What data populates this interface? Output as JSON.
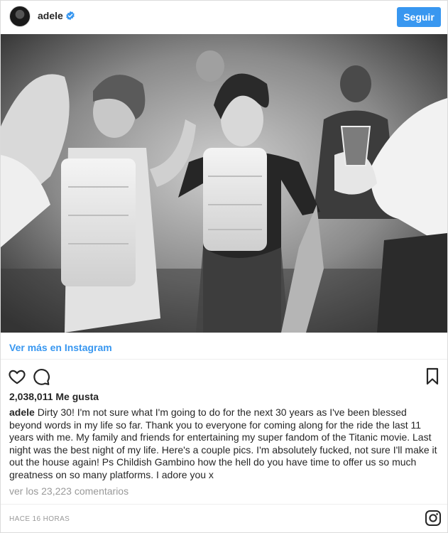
{
  "header": {
    "username": "adele",
    "verified": true,
    "follow_label": "Seguir"
  },
  "post": {
    "photo_icon": "image",
    "view_link": "Ver más en Instagram",
    "likes": "2,038,011 Me gusta",
    "caption_user": "adele",
    "caption_text": "Dirty 30! I'm not sure what I'm going to do for the next 30 years as I've been blessed beyond words in my life so far. Thank you to everyone for coming along for the ride the last 11 years with me. My family and friends for entertaining my super fandom of the Titanic movie. Last night was the best night of my life. Here's a couple pics. I'm absolutely fucked, not sure I'll make it out the house again! Ps Childish Gambino how the hell do you have time to offer us so much greatness on so many platforms. I adore you x",
    "comments_link": "ver los 23,223 comentarios",
    "timestamp": "HACE 16 HORAS"
  },
  "icons": {
    "like": "heart-outline-icon",
    "comment": "speech-bubble-icon",
    "save": "bookmark-icon",
    "verified": "verified-badge-icon",
    "brand": "instagram-glyph-icon"
  },
  "colors": {
    "accent": "#3897f0",
    "text": "#262626",
    "muted": "#999999",
    "border": "#dbdbdb"
  }
}
